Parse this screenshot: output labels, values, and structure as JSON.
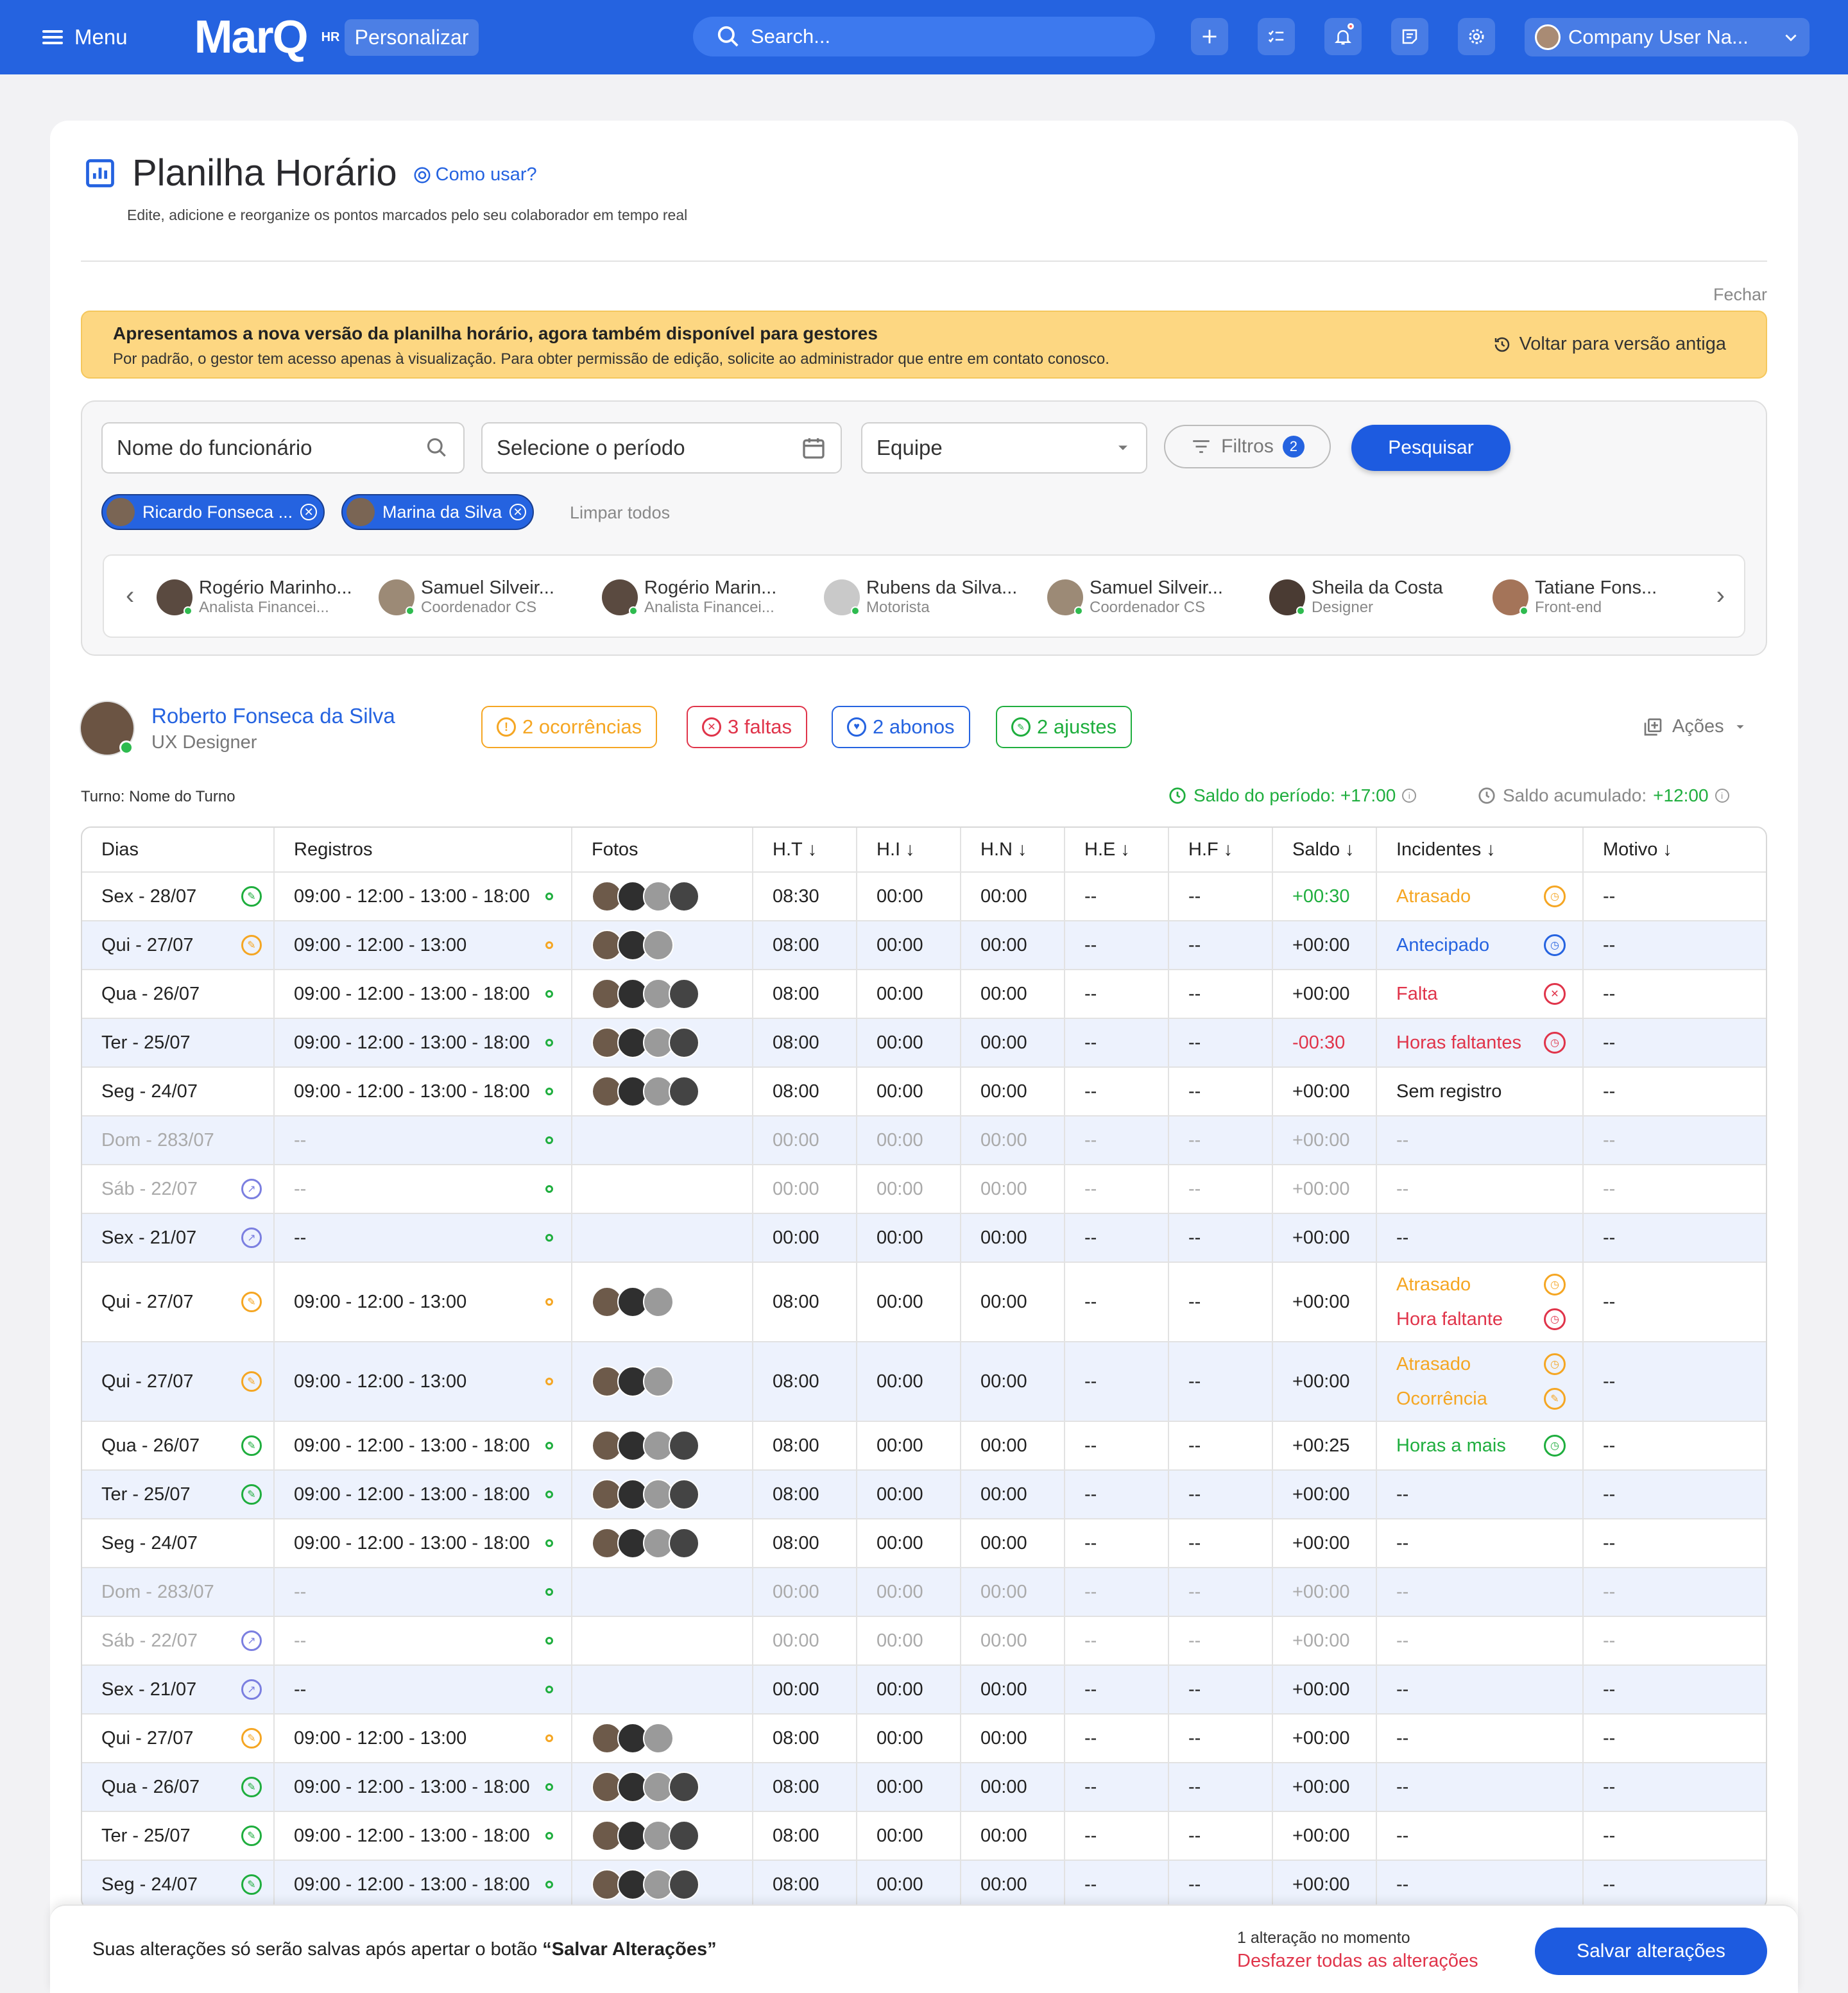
{
  "topbar": {
    "menu": "Menu",
    "logo": "MarQ",
    "logo_sub": "HR",
    "personalizar": "Personalizar",
    "search_placeholder": "Search...",
    "company_user": "Company User Na..."
  },
  "page": {
    "title": "Planilha Horário",
    "how_to": "Como usar?",
    "subtitle": "Edite, adicione e reorganize os pontos marcados pelo seu colaborador em tempo real",
    "close": "Fechar"
  },
  "banner": {
    "title": "Apresentamos a nova versão da planilha horário, agora também disponível para gestores",
    "text": "Por padrão, o gestor tem acesso apenas à visualização. Para obter permissão de edição, solicite ao administrador que entre em contato conosco.",
    "back": "Voltar para versão antiga"
  },
  "filters": {
    "employee_placeholder": "Nome do funcionário",
    "period_placeholder": "Selecione o período",
    "team": "Equipe",
    "filters_label": "Filtros",
    "filters_count": "2",
    "search_btn": "Pesquisar",
    "chips": [
      "Ricardo Fonseca ...",
      "Marina da Silva"
    ],
    "clear_all": "Limpar todos"
  },
  "carousel": [
    {
      "name": "Rogério Marinho...",
      "role": "Analista Financei..."
    },
    {
      "name": "Samuel Silveir...",
      "role": "Coordenador CS"
    },
    {
      "name": "Rogério Marin...",
      "role": "Analista Financei..."
    },
    {
      "name": "Rubens da Silva...",
      "role": "Motorista"
    },
    {
      "name": "Samuel Silveir...",
      "role": "Coordenador CS"
    },
    {
      "name": "Sheila da Costa",
      "role": "Designer"
    },
    {
      "name": "Tatiane Fons...",
      "role": "Front-end"
    }
  ],
  "profile": {
    "name": "Roberto Fonseca da Silva",
    "role": "UX Designer",
    "occurrences": "2 ocorrências",
    "absences": "3 faltas",
    "abonos": "2 abonos",
    "adjustments": "2 ajustes",
    "actions": "Ações",
    "shift": "Turno: Nome do Turno",
    "period_balance": "Saldo do período: +17:00",
    "acc_balance_label": "Saldo acumulado: ",
    "acc_balance_value": "+12:00"
  },
  "colors": {
    "primary": "#2563e0",
    "green": "#1fae3e",
    "orange": "#f5a623",
    "red": "#e0344a",
    "purple": "#7b7fe0",
    "banner": "#fdd782"
  },
  "table": {
    "headers": [
      "Dias",
      "Registros",
      "Fotos",
      "H.T",
      "H.I",
      "H.N",
      "H.E",
      "H.F",
      "Saldo",
      "Incidentes",
      "Motivo"
    ],
    "rows": [
      {
        "day": "Sex - 28/07",
        "dayIcon": "green",
        "reg": "09:00 - 12:00 - 13:00 - 18:00",
        "dot": "green",
        "photos": 4,
        "ht": "08:30",
        "hi": "00:00",
        "hn": "00:00",
        "he": "--",
        "hf": "--",
        "saldo": "+00:30",
        "saldoColor": "green",
        "inc": [
          {
            "t": "Atrasado",
            "c": "orange"
          }
        ],
        "motivo": "--"
      },
      {
        "day": "Qui - 27/07",
        "dayIcon": "orange",
        "reg": "09:00 - 12:00 - 13:00",
        "dot": "orange",
        "photos": 3,
        "ht": "08:00",
        "hi": "00:00",
        "hn": "00:00",
        "he": "--",
        "hf": "--",
        "saldo": "+00:00",
        "inc": [
          {
            "t": "Antecipado",
            "c": "blue"
          }
        ],
        "motivo": "--"
      },
      {
        "day": "Qua - 26/07",
        "dayIcon": "",
        "reg": "09:00 - 12:00 - 13:00 - 18:00",
        "dot": "green",
        "photos": 4,
        "ht": "08:00",
        "hi": "00:00",
        "hn": "00:00",
        "he": "--",
        "hf": "--",
        "saldo": "+00:00",
        "inc": [
          {
            "t": "Falta",
            "c": "red"
          }
        ],
        "motivo": "--"
      },
      {
        "day": "Ter - 25/07",
        "dayIcon": "",
        "reg": "09:00 - 12:00 - 13:00 - 18:00",
        "dot": "green",
        "photos": 4,
        "ht": "08:00",
        "hi": "00:00",
        "hn": "00:00",
        "he": "--",
        "hf": "--",
        "saldo": "-00:30",
        "saldoColor": "red",
        "inc": [
          {
            "t": "Horas faltantes",
            "c": "red"
          }
        ],
        "motivo": "--"
      },
      {
        "day": "Seg - 24/07",
        "dayIcon": "",
        "reg": "09:00 - 12:00 - 13:00 - 18:00",
        "dot": "green",
        "photos": 4,
        "ht": "08:00",
        "hi": "00:00",
        "hn": "00:00",
        "he": "--",
        "hf": "--",
        "saldo": "+00:00",
        "inc": [
          {
            "t": "Sem registro",
            "c": "plain"
          }
        ],
        "motivo": "--"
      },
      {
        "day": "Dom - 283/07",
        "dim": true,
        "dayIcon": "",
        "reg": "--",
        "dot": "green",
        "photos": 0,
        "ht": "00:00",
        "hi": "00:00",
        "hn": "00:00",
        "he": "--",
        "hf": "--",
        "saldo": "+00:00",
        "inc": [
          {
            "t": "--",
            "c": "none"
          }
        ],
        "motivo": "--"
      },
      {
        "day": "Sáb - 22/07",
        "dim": true,
        "dayIcon": "purple",
        "reg": "--",
        "dot": "green",
        "photos": 0,
        "ht": "00:00",
        "hi": "00:00",
        "hn": "00:00",
        "he": "--",
        "hf": "--",
        "saldo": "+00:00",
        "inc": [
          {
            "t": "--",
            "c": "none"
          }
        ],
        "motivo": "--"
      },
      {
        "day": "Sex - 21/07",
        "dayIcon": "purple",
        "reg": "--",
        "dot": "green",
        "photos": 0,
        "ht": "00:00",
        "hi": "00:00",
        "hn": "00:00",
        "he": "--",
        "hf": "--",
        "saldo": "+00:00",
        "inc": [
          {
            "t": "--",
            "c": "none"
          }
        ],
        "motivo": "--"
      },
      {
        "day": "Qui - 27/07",
        "dayIcon": "orange",
        "reg": "09:00 - 12:00 - 13:00",
        "dot": "orange",
        "photos": 3,
        "ht": "08:00",
        "hi": "00:00",
        "hn": "00:00",
        "he": "--",
        "hf": "--",
        "saldo": "+00:00",
        "inc": [
          {
            "t": "Atrasado",
            "c": "orange"
          },
          {
            "t": "Hora faltante",
            "c": "red"
          }
        ],
        "motivo": "--"
      },
      {
        "day": "Qui - 27/07",
        "dayIcon": "orange",
        "reg": "09:00 - 12:00 - 13:00",
        "dot": "orange",
        "photos": 3,
        "ht": "08:00",
        "hi": "00:00",
        "hn": "00:00",
        "he": "--",
        "hf": "--",
        "saldo": "+00:00",
        "inc": [
          {
            "t": "Atrasado",
            "c": "orange"
          },
          {
            "t": "Ocorrência",
            "c": "orange"
          }
        ],
        "motivo": "--"
      },
      {
        "day": "Qua - 26/07",
        "dayIcon": "green",
        "reg": "09:00 - 12:00 - 13:00 - 18:00",
        "dot": "green",
        "photos": 4,
        "ht": "08:00",
        "hi": "00:00",
        "hn": "00:00",
        "he": "--",
        "hf": "--",
        "saldo": "+00:25",
        "inc": [
          {
            "t": "Horas a mais",
            "c": "green"
          }
        ],
        "motivo": "--"
      },
      {
        "day": "Ter - 25/07",
        "dayIcon": "green",
        "reg": "09:00 - 12:00 - 13:00 - 18:00",
        "dot": "green",
        "photos": 4,
        "ht": "08:00",
        "hi": "00:00",
        "hn": "00:00",
        "he": "--",
        "hf": "--",
        "saldo": "+00:00",
        "inc": [
          {
            "t": "--",
            "c": "none"
          }
        ],
        "motivo": "--"
      },
      {
        "day": "Seg - 24/07",
        "dayIcon": "",
        "reg": "09:00 - 12:00 - 13:00 - 18:00",
        "dot": "green",
        "photos": 4,
        "ht": "08:00",
        "hi": "00:00",
        "hn": "00:00",
        "he": "--",
        "hf": "--",
        "saldo": "+00:00",
        "inc": [
          {
            "t": "--",
            "c": "none"
          }
        ],
        "motivo": "--"
      },
      {
        "day": "Dom - 283/07",
        "dim": true,
        "dayIcon": "",
        "reg": "--",
        "dot": "green",
        "photos": 0,
        "ht": "00:00",
        "hi": "00:00",
        "hn": "00:00",
        "he": "--",
        "hf": "--",
        "saldo": "+00:00",
        "inc": [
          {
            "t": "--",
            "c": "none"
          }
        ],
        "motivo": "--"
      },
      {
        "day": "Sáb - 22/07",
        "dim": true,
        "dayIcon": "purple",
        "reg": "--",
        "dot": "green",
        "photos": 0,
        "ht": "00:00",
        "hi": "00:00",
        "hn": "00:00",
        "he": "--",
        "hf": "--",
        "saldo": "+00:00",
        "inc": [
          {
            "t": "--",
            "c": "none"
          }
        ],
        "motivo": "--"
      },
      {
        "day": "Sex - 21/07",
        "dayIcon": "purple",
        "reg": "--",
        "dot": "green",
        "photos": 0,
        "ht": "00:00",
        "hi": "00:00",
        "hn": "00:00",
        "he": "--",
        "hf": "--",
        "saldo": "+00:00",
        "inc": [
          {
            "t": "--",
            "c": "none"
          }
        ],
        "motivo": "--"
      },
      {
        "day": "Qui - 27/07",
        "dayIcon": "orange",
        "reg": "09:00 - 12:00 - 13:00",
        "dot": "orange",
        "photos": 3,
        "ht": "08:00",
        "hi": "00:00",
        "hn": "00:00",
        "he": "--",
        "hf": "--",
        "saldo": "+00:00",
        "inc": [
          {
            "t": "--",
            "c": "none"
          }
        ],
        "motivo": "--"
      },
      {
        "day": "Qua - 26/07",
        "dayIcon": "green",
        "reg": "09:00 - 12:00 - 13:00 - 18:00",
        "dot": "green",
        "photos": 4,
        "ht": "08:00",
        "hi": "00:00",
        "hn": "00:00",
        "he": "--",
        "hf": "--",
        "saldo": "+00:00",
        "inc": [
          {
            "t": "--",
            "c": "none"
          }
        ],
        "motivo": "--"
      },
      {
        "day": "Ter - 25/07",
        "dayIcon": "green",
        "reg": "09:00 - 12:00 - 13:00 - 18:00",
        "dot": "green",
        "photos": 4,
        "ht": "08:00",
        "hi": "00:00",
        "hn": "00:00",
        "he": "--",
        "hf": "--",
        "saldo": "+00:00",
        "inc": [
          {
            "t": "--",
            "c": "none"
          }
        ],
        "motivo": "--"
      },
      {
        "day": "Seg - 24/07",
        "dayIcon": "green",
        "reg": "09:00 - 12:00 - 13:00 - 18:00",
        "dot": "green",
        "photos": 4,
        "ht": "08:00",
        "hi": "00:00",
        "hn": "00:00",
        "he": "--",
        "hf": "--",
        "saldo": "+00:00",
        "inc": [
          {
            "t": "--",
            "c": "none"
          }
        ],
        "motivo": "--"
      }
    ]
  },
  "footer": {
    "message_prefix": "Suas alterações só serão salvas após apertar o botão ",
    "message_bold": "“Salvar Alterações”",
    "changes": "1 alteração no momento",
    "undo": "Desfazer todas as alterações",
    "save": "Salvar alterações"
  }
}
